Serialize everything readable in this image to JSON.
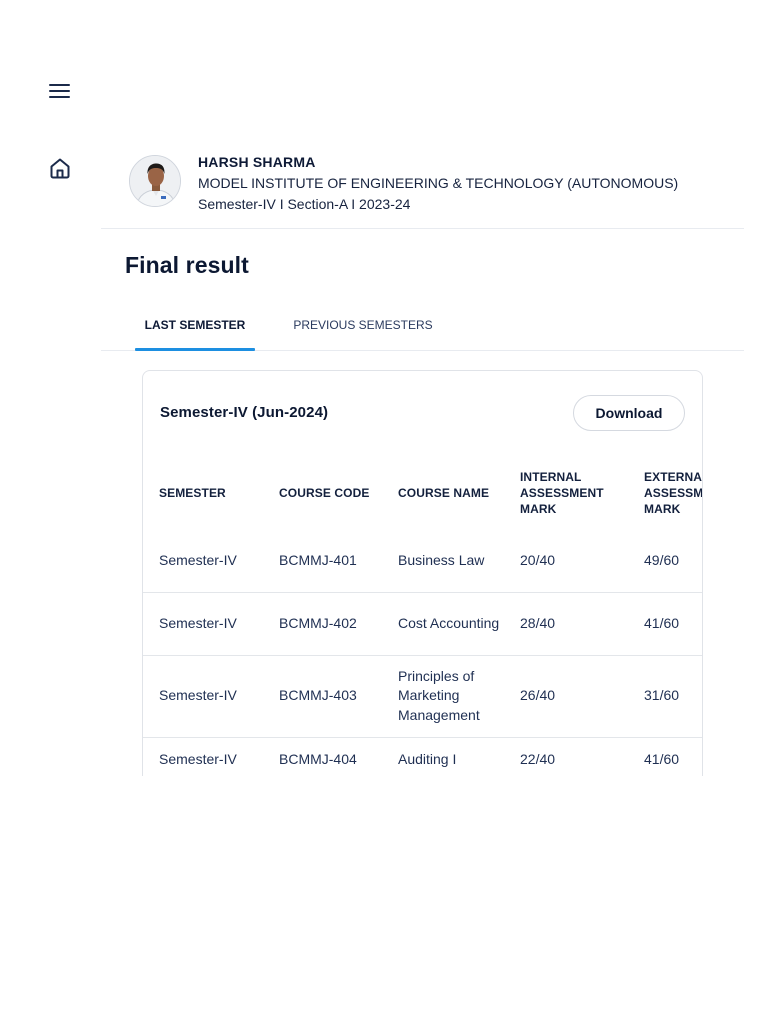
{
  "icons": {
    "menu": "hamburger-menu-icon",
    "home": "home-icon",
    "avatar": "student-avatar"
  },
  "colors": {
    "accent": "#1d8fe1",
    "text_primary": "#0c1832",
    "divider": "#e8ebf0"
  },
  "profile": {
    "name": "HARSH SHARMA",
    "institute": "MODEL INSTITUTE OF ENGINEERING & TECHNOLOGY (AUTONOMOUS)",
    "semester_line": "Semester-IV I Section-A I 2023-24"
  },
  "page": {
    "title": "Final result"
  },
  "tabs": [
    {
      "label": "LAST SEMESTER",
      "active": true
    },
    {
      "label": "PREVIOUS SEMESTERS",
      "active": false
    }
  ],
  "card": {
    "title": "Semester-IV (Jun-2024)",
    "download_label": "Download"
  },
  "table": {
    "headers": [
      "SEMESTER",
      "COURSE CODE",
      "COURSE NAME",
      "INTERNAL ASSESSMENT MARK",
      "EXTERNAL ASSESSMENT MARK"
    ],
    "rows": [
      [
        "Semester-IV",
        "BCMMJ-401",
        "Business Law",
        "20/40",
        "49/60"
      ],
      [
        "Semester-IV",
        "BCMMJ-402",
        "Cost Accounting",
        "28/40",
        "41/60"
      ],
      [
        "Semester-IV",
        "BCMMJ-403",
        "Principles of Marketing Management",
        "26/40",
        "31/60"
      ],
      [
        "Semester-IV",
        "BCMMJ-404",
        "Auditing I",
        "22/40",
        "41/60"
      ]
    ]
  }
}
